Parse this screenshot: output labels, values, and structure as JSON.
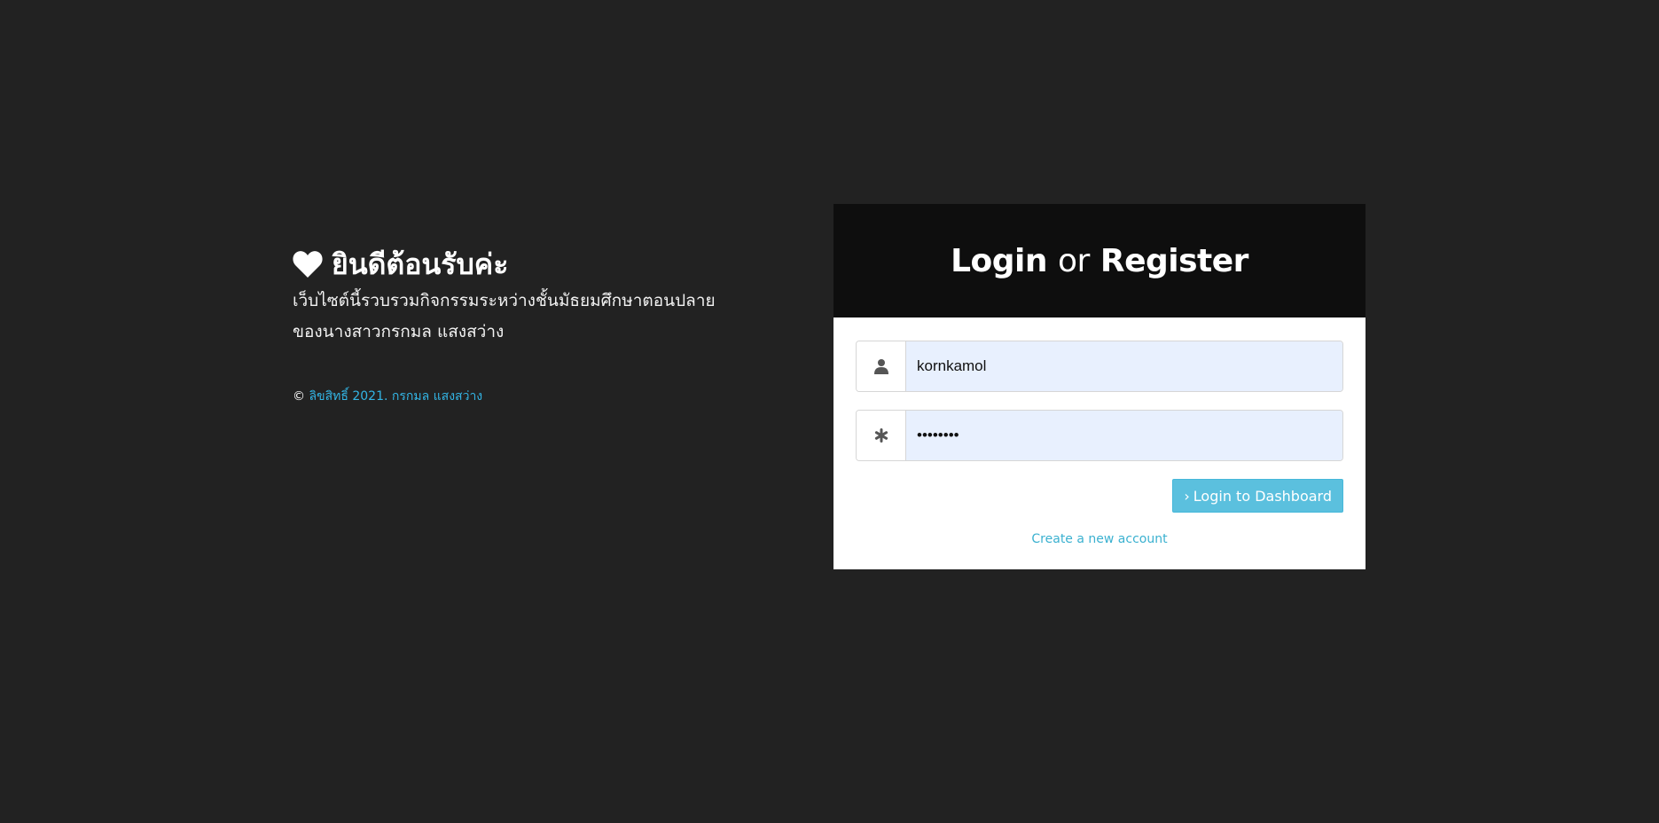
{
  "welcome": {
    "title": "ยินดีต้อนรับค่ะ",
    "description_line1": "เว็บไซต์นี้รวบรวมกิจกรรมระหว่างชั้นมัธยมศึกษาตอนปลาย",
    "description_line2": "ของนางสาวกรกมล แสงสว่าง",
    "copyright_symbol": "©",
    "copyright_text": "ลิขสิทธิ์ 2021. กรกมล แสงสว่าง",
    "icon": "heart-icon"
  },
  "login": {
    "header_login": "Login",
    "header_or": "or",
    "header_register": "Register",
    "username_value": "kornkamol",
    "password_value": "••••••••",
    "submit_arrow": "›",
    "submit_label": "Login to Dashboard",
    "create_account_label": "Create a new account",
    "icons": [
      "user-icon",
      "asterisk-icon"
    ]
  },
  "colors": {
    "page_background": "#222222",
    "header_background": "#0e0e0e",
    "accent": "#5bc0de",
    "link": "#33b5e5",
    "input_background": "#e8f0fe"
  }
}
